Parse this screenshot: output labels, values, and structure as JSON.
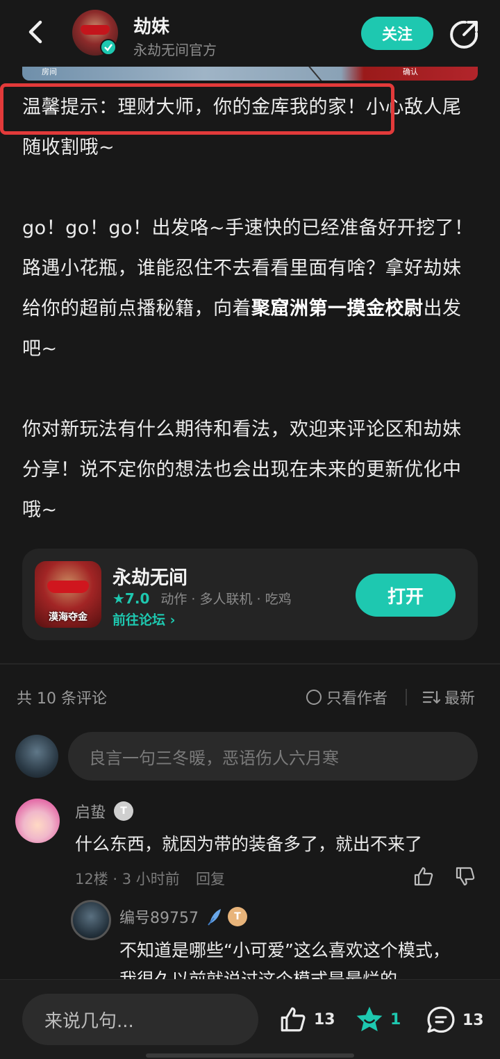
{
  "header": {
    "author_name": "劫妹",
    "author_subtitle": "永劫无间官方",
    "follow_label": "关注"
  },
  "image_strip": {
    "left_label": "房间",
    "right_label": "确认"
  },
  "article": {
    "tip": "温馨提示：理财大师，你的金库我的家！",
    "tip_rest": "小心敌人尾随收割哦~",
    "p2_a": "go！go！go！出发咯~手速快的已经准备好开挖了！路遇小花瓶，谁能忍住不去看看里面有啥？拿好劫妹给你的超前点播秘籍，向着",
    "p2_bold": "聚窟洲第一摸金校尉",
    "p2_b": "出发吧~",
    "p3": "你对新玩法有什么期待和看法，欢迎来评论区和劫妹分享！说不定你的想法也会出现在未来的更新优化中哦~"
  },
  "game_card": {
    "icon_caption": "漠海夺金",
    "title": "永劫无间",
    "rating": "★7.0",
    "tags": "动作 · 多人联机 · 吃鸡",
    "forum_link": "前往论坛 ›",
    "open_label": "打开"
  },
  "comments_header": {
    "count": "共 10 条评论",
    "author_only": "只看作者",
    "sort": "最新"
  },
  "comment_input": {
    "placeholder": "良言一句三冬暖，恶语伤人六月寒"
  },
  "comments": [
    {
      "name": "启蛰",
      "badge": "T",
      "text": "什么东西，就因为带的装备多了，就出不来了",
      "meta": "12楼 · 3 小时前",
      "reply_label": "回复",
      "replies": [
        {
          "name": "编号89757",
          "badge": "T",
          "text": "不知道是哪些“小可爱”这么喜欢这个模式，我很久以前就说过这个模式是最烂的"
        }
      ]
    }
  ],
  "bottom_bar": {
    "input_placeholder": "来说几句...",
    "like_count": "13",
    "fav_count": "1",
    "comment_count": "13"
  },
  "colors": {
    "accent": "#1ec8b0",
    "highlight": "#e23a3a",
    "background": "#181818"
  }
}
